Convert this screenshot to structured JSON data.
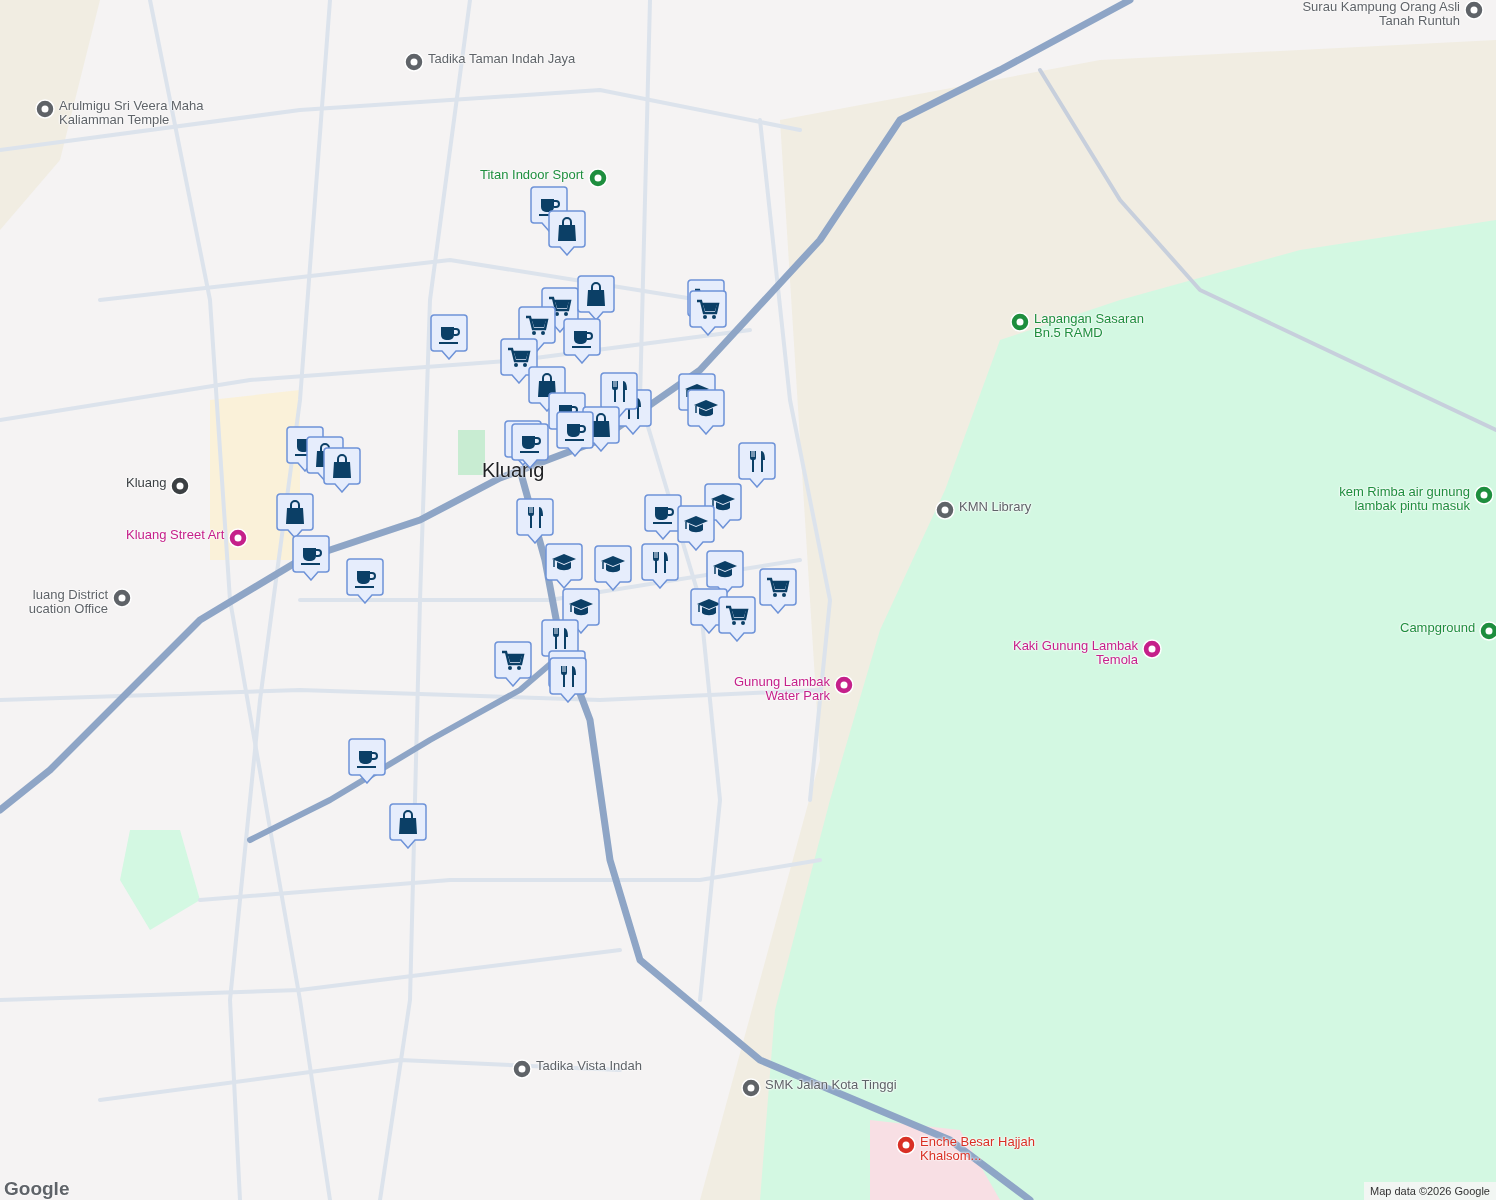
{
  "map": {
    "town_label": "Kluang",
    "pois": [
      {
        "kind": "school",
        "label": "Tadika Taman Indah Jaya"
      },
      {
        "kind": "temple",
        "label": "Arulmigu Sri Veera Maha Kaliamman Temple"
      },
      {
        "kind": "sport",
        "label": "Titan Indoor Sport"
      },
      {
        "kind": "station",
        "label": "Kluang"
      },
      {
        "kind": "art",
        "label": "Kluang Street Art"
      },
      {
        "kind": "office",
        "label": "luang District ucation Office"
      },
      {
        "kind": "library",
        "label": "KMN Library"
      },
      {
        "kind": "sport",
        "label": "Lapangan Sasaran Bn.5 RAMD"
      },
      {
        "kind": "camp",
        "label": "kem Rimba air gunung lambak pintu masuk"
      },
      {
        "kind": "camp",
        "label": "Campground"
      },
      {
        "kind": "art",
        "label": "Kaki Gunung Lambak Temola"
      },
      {
        "kind": "park",
        "label": "Gunung Lambak Water Park"
      },
      {
        "kind": "school",
        "label": "Tadika Vista Indah"
      },
      {
        "kind": "school",
        "label": "SMK Jalan Kota Tinggi"
      },
      {
        "kind": "hospital",
        "label": "Enche Besar Hajjah Khalsom..."
      },
      {
        "kind": "temple",
        "label": "Surau Kampung Orang Asli Tanah Runtuh"
      }
    ],
    "markers": [
      {
        "kind": "cup"
      },
      {
        "kind": "bag"
      },
      {
        "kind": "cart"
      },
      {
        "kind": "bag"
      },
      {
        "kind": "cart"
      },
      {
        "kind": "cup"
      },
      {
        "kind": "cart"
      },
      {
        "kind": "cup"
      },
      {
        "kind": "cart"
      },
      {
        "kind": "cart"
      },
      {
        "kind": "bag"
      },
      {
        "kind": "cup"
      },
      {
        "kind": "food"
      },
      {
        "kind": "food"
      },
      {
        "kind": "bag"
      },
      {
        "kind": "cup"
      },
      {
        "kind": "cup"
      },
      {
        "kind": "cup"
      },
      {
        "kind": "school"
      },
      {
        "kind": "school"
      },
      {
        "kind": "food"
      },
      {
        "kind": "cup"
      },
      {
        "kind": "bag"
      },
      {
        "kind": "bag"
      },
      {
        "kind": "bag"
      },
      {
        "kind": "food"
      },
      {
        "kind": "cup"
      },
      {
        "kind": "school"
      },
      {
        "kind": "school"
      },
      {
        "kind": "cup"
      },
      {
        "kind": "cup"
      },
      {
        "kind": "school"
      },
      {
        "kind": "school"
      },
      {
        "kind": "food"
      },
      {
        "kind": "school"
      },
      {
        "kind": "cart"
      },
      {
        "kind": "school"
      },
      {
        "kind": "school"
      },
      {
        "kind": "cart"
      },
      {
        "kind": "food"
      },
      {
        "kind": "cart"
      },
      {
        "kind": "food"
      },
      {
        "kind": "food"
      },
      {
        "kind": "cup"
      },
      {
        "kind": "bag"
      }
    ],
    "logo": "Google",
    "attribution": "Map data ©2026 Google"
  }
}
